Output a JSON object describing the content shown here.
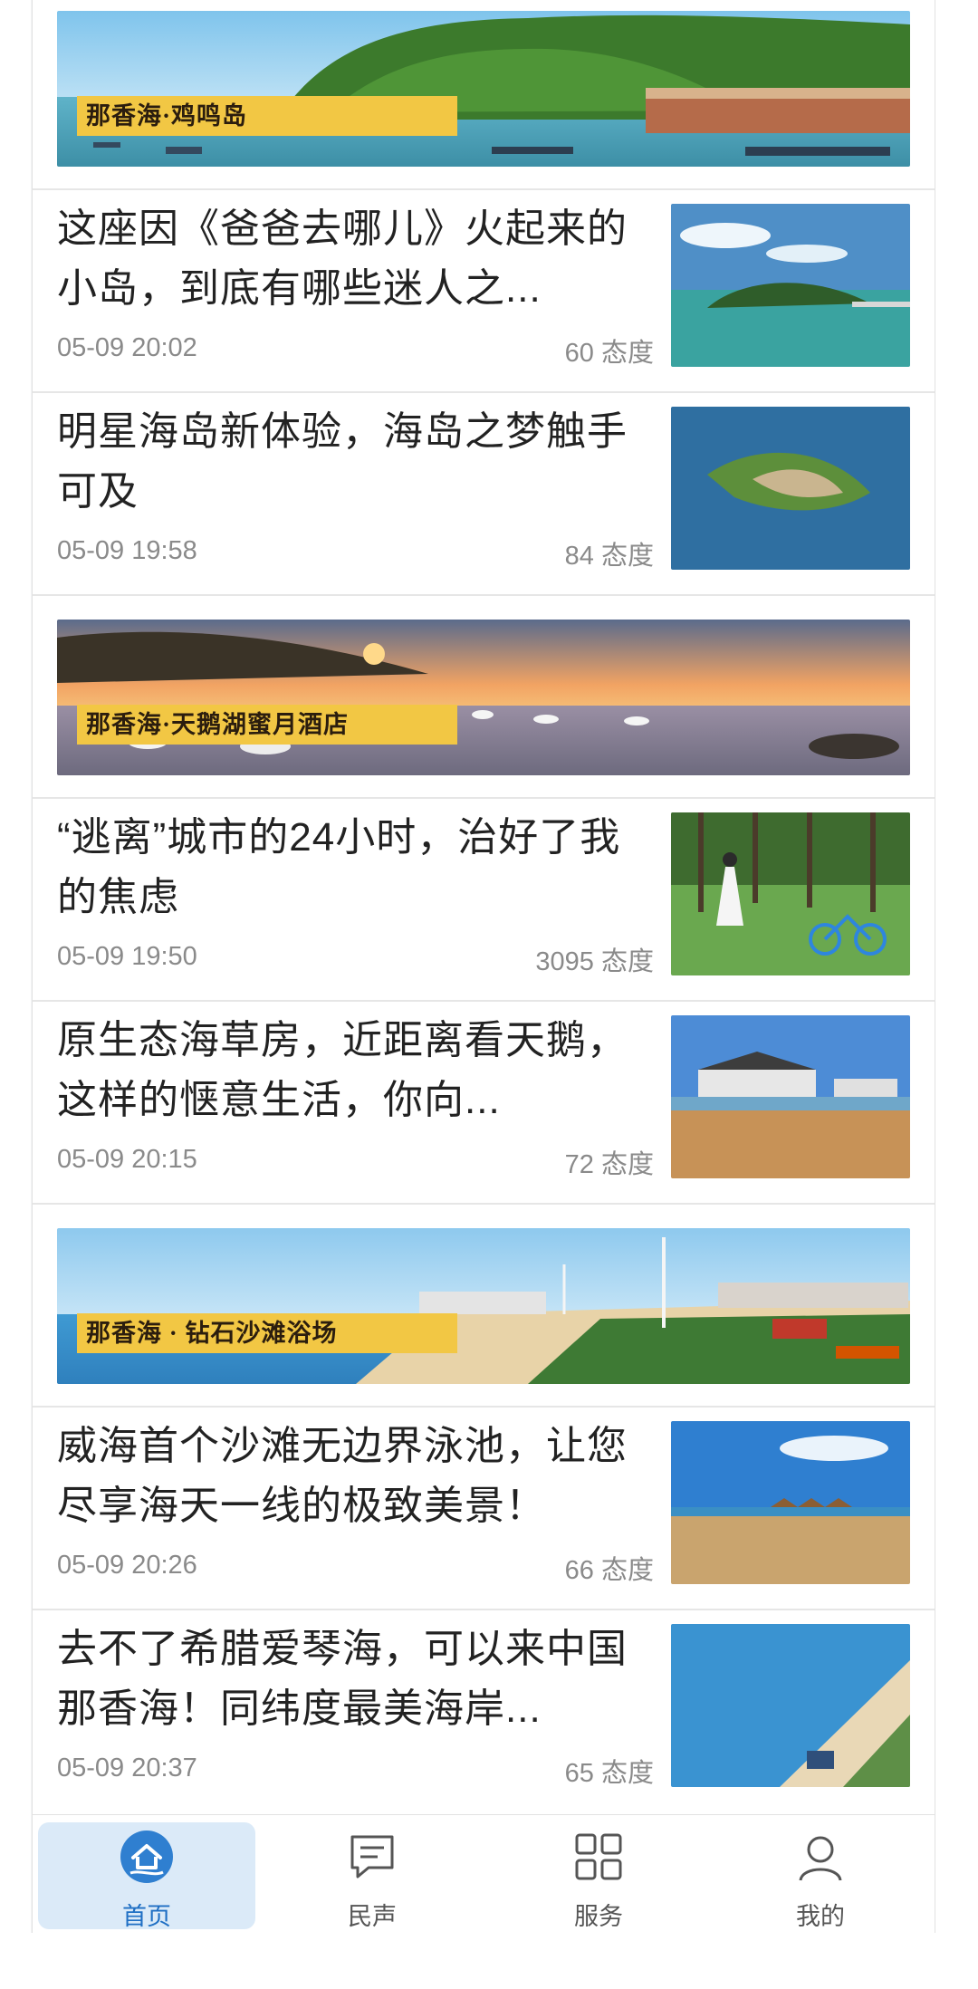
{
  "banners": [
    {
      "label": "那香海·鸡鸣岛"
    },
    {
      "label": "那香海·天鹅湖蜜月酒店"
    },
    {
      "label": "那香海 · 钻石沙滩浴场"
    }
  ],
  "articles": [
    {
      "title": "这座因《爸爸去哪儿》火起来的小岛，到底有哪些迷人之...",
      "time": "05-09 20:02",
      "attitude": "60 态度"
    },
    {
      "title": "明星海岛新体验，海岛之梦触手可及",
      "time": "05-09 19:58",
      "attitude": "84 态度"
    },
    {
      "title": "“逃离”城市的24小时，治好了我的焦虑",
      "time": "05-09 19:50",
      "attitude": "3095 态度"
    },
    {
      "title": "原生态海草房，近距离看天鹅，这样的惬意生活，你向...",
      "time": "05-09 20:15",
      "attitude": "72 态度"
    },
    {
      "title": "威海首个沙滩无边界泳池，让您尽享海天一线的极致美景！",
      "time": "05-09 20:26",
      "attitude": "66 态度"
    },
    {
      "title": "去不了希腊爱琴海，可以来中国那香海！同纬度最美海岸...",
      "time": "05-09 20:37",
      "attitude": "65 态度"
    }
  ],
  "tabbar": {
    "items": [
      {
        "label": "首页",
        "icon": "home-icon",
        "active": true
      },
      {
        "label": "民声",
        "icon": "message-icon",
        "active": false
      },
      {
        "label": "服务",
        "icon": "grid-icon",
        "active": false
      },
      {
        "label": "我的",
        "icon": "user-icon",
        "active": false
      }
    ]
  },
  "colors": {
    "accent": "#1f6fc4",
    "active_tab_bg": "#dbeaf8",
    "banner_label_bg": "#f2c744"
  }
}
